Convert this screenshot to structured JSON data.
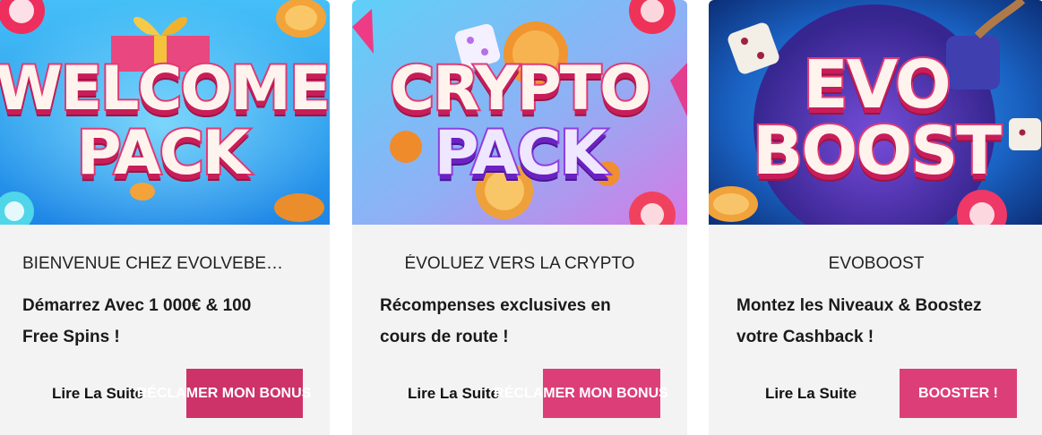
{
  "cards": [
    {
      "banner_line1": "WELCOME",
      "banner_line2": "PACK",
      "subtitle": "BIENVENUE CHEZ EVOLVEBE…",
      "headline": "Démarrez Avec 1 000€ & 100 Free Spins !",
      "read_more": "Lire La Suite",
      "cta": "RÉCLAMER MON BONUS",
      "colors": {
        "bg_top": "#3fb8f5",
        "bg_bottom": "#1f7fe0",
        "cta": "#cd3269"
      }
    },
    {
      "banner_line1": "CRYPTO",
      "banner_line2": "PACK",
      "subtitle": "ÉVOLUEZ VERS LA CRYPTO",
      "headline": "Récompenses exclusives en cours de route !",
      "read_more": "Lire La Suite",
      "cta": "RÉCLAMER MON BONUS",
      "colors": {
        "bg_top": "#59c7f7",
        "bg_bottom": "#c27be8",
        "cta": "#dc3f77"
      }
    },
    {
      "banner_line1": "EVO",
      "banner_line2": "BOOST",
      "subtitle": "EVOBOOST",
      "headline": "Montez les Niveaux & Boostez votre Cashback !",
      "read_more": "Lire La Suite",
      "cta": "BOOSTER !",
      "colors": {
        "bg_top": "#2b8fe0",
        "bg_bottom": "#0c3a8a",
        "cta": "#dc3f77"
      }
    }
  ]
}
